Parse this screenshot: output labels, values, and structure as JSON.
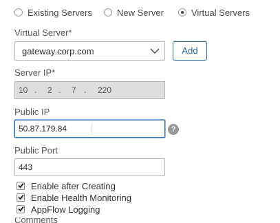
{
  "server_type": {
    "options": [
      {
        "label": "Existing Servers",
        "checked": false
      },
      {
        "label": "New Server",
        "checked": false
      },
      {
        "label": "Virtual Servers",
        "checked": true
      }
    ]
  },
  "virtual_server": {
    "label": "Virtual Server*",
    "selected": "gateway.corp.com",
    "add_label": "Add"
  },
  "server_ip": {
    "label": "Server IP*",
    "octets": [
      "10",
      "2",
      "7",
      "220"
    ],
    "separator": "."
  },
  "public_ip": {
    "label": "Public IP",
    "value": "50.87.179.84",
    "help": "?"
  },
  "public_port": {
    "label": "Public Port",
    "value": "443"
  },
  "options": {
    "items": [
      {
        "label": "Enable after Creating",
        "checked": true
      },
      {
        "label": "Enable Health Monitoring",
        "checked": true
      },
      {
        "label": "AppFlow Logging",
        "checked": true
      }
    ]
  },
  "next_section_label": "Comments"
}
